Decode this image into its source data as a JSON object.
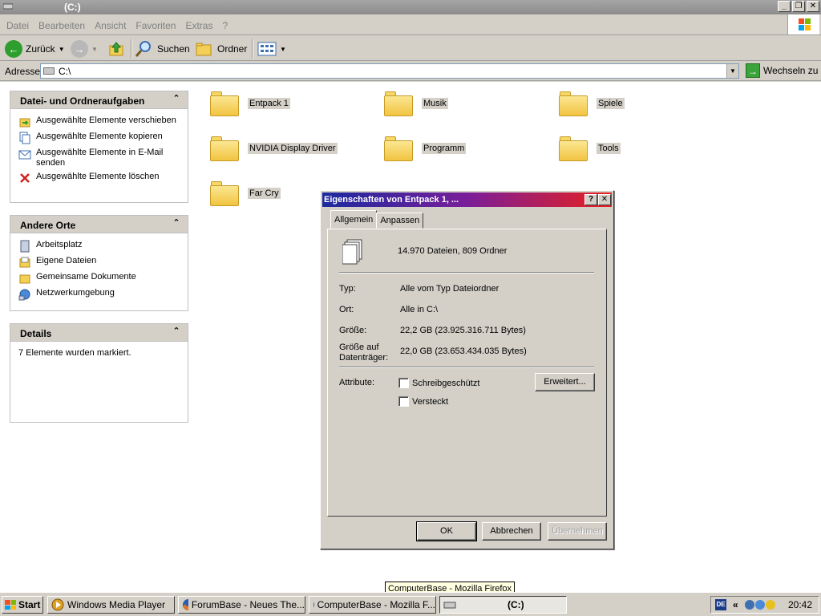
{
  "window": {
    "title": "(C:)"
  },
  "menu": [
    "Datei",
    "Bearbeiten",
    "Ansicht",
    "Favoriten",
    "Extras",
    "?"
  ],
  "toolbar": {
    "back": "Zurück",
    "search": "Suchen",
    "folders": "Ordner"
  },
  "address": {
    "label": "Adresse",
    "value": "C:\\",
    "go": "Wechseln zu"
  },
  "tasks": {
    "file_folder": {
      "title": "Datei- und Ordneraufgaben",
      "items": [
        "Ausgewählte Elemente verschieben",
        "Ausgewählte Elemente kopieren",
        "Ausgewählte Elemente in E-Mail senden",
        "Ausgewählte Elemente löschen"
      ]
    },
    "other_places": {
      "title": "Andere Orte",
      "items": [
        "Arbeitsplatz",
        "Eigene Dateien",
        "Gemeinsame Dokumente",
        "Netzwerkumgebung"
      ]
    },
    "details": {
      "title": "Details",
      "text": "7 Elemente wurden markiert."
    }
  },
  "folders": [
    "Entpack 1",
    "Musik",
    "Spiele",
    "NVIDIA Display Driver",
    "Programm",
    "Tools",
    "Far Cry"
  ],
  "dialog": {
    "title": "Eigenschaften von Entpack 1, ...",
    "tabs": [
      "Allgemein",
      "Anpassen"
    ],
    "summary": "14.970 Dateien, 809 Ordner",
    "rows": [
      {
        "label": "Typ:",
        "value": "Alle vom Typ Dateiordner"
      },
      {
        "label": "Ort:",
        "value": "Alle in C:\\"
      },
      {
        "label": "Größe:",
        "value": "22,2 GB (23.925.316.711 Bytes)"
      },
      {
        "label": "Größe auf Datenträger:",
        "value": "22,0 GB (23.653.434.035 Bytes)"
      }
    ],
    "attributes_label": "Attribute:",
    "readonly": "Schreibgeschützt",
    "hidden": "Versteckt",
    "advanced": "Erweitert...",
    "ok": "OK",
    "cancel": "Abbrechen",
    "apply": "Übernehmen"
  },
  "tooltip": "ComputerBase - Mozilla Firefox",
  "taskbar": {
    "start": "Start",
    "tasks": [
      "Windows Media Player",
      "ForumBase - Neues The...",
      "ComputerBase - Mozilla F...",
      "(C:)"
    ],
    "lang": "DE",
    "chevron": "«",
    "clock": "20:42"
  }
}
